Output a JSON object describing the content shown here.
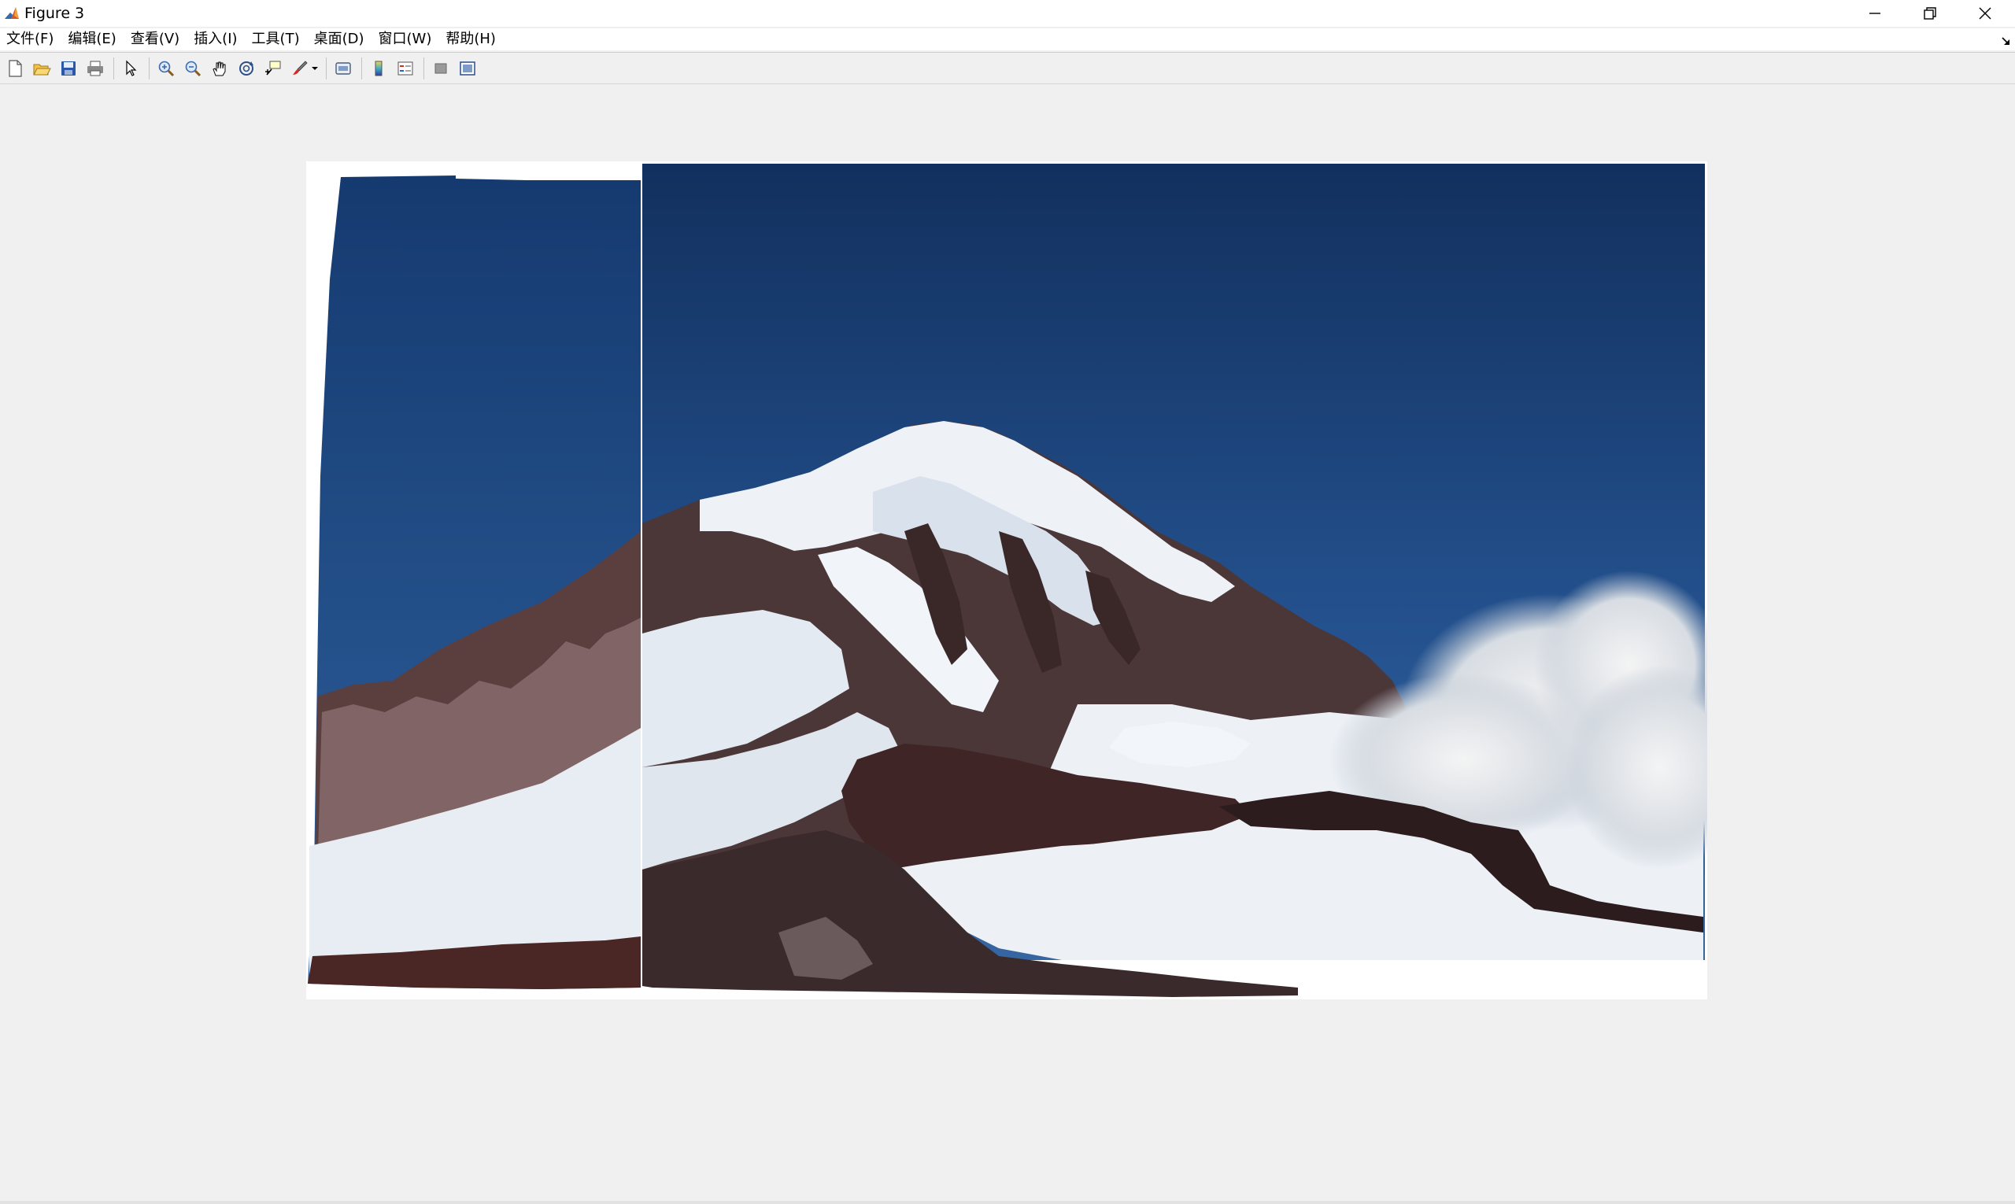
{
  "window": {
    "title": "Figure 3",
    "app_icon": "matlab-icon",
    "controls": {
      "minimize_icon": "minimize-icon",
      "restore_icon": "restore-icon",
      "close_icon": "close-icon"
    }
  },
  "menu": {
    "items": [
      {
        "label": "文件(F)"
      },
      {
        "label": "编辑(E)"
      },
      {
        "label": "查看(V)"
      },
      {
        "label": "插入(I)"
      },
      {
        "label": "工具(T)"
      },
      {
        "label": "桌面(D)"
      },
      {
        "label": "窗口(W)"
      },
      {
        "label": "帮助(H)"
      }
    ],
    "dock_icon": "dock-arrow-icon"
  },
  "toolbar": {
    "buttons": [
      "new-figure-icon",
      "open-file-icon",
      "save-icon",
      "print-icon",
      "edit-plot-icon",
      "zoom-in-icon",
      "zoom-out-icon",
      "pan-icon",
      "rotate-3d-icon",
      "data-cursor-icon",
      "brush-icon",
      "link-plot-icon",
      "insert-colorbar-icon",
      "insert-legend-icon",
      "hide-plot-tools-icon",
      "show-plot-tools-icon"
    ]
  },
  "colors": {
    "sky_top": "#13305e",
    "sky_bottom": "#2c5d96",
    "snow": "#e9eef4",
    "rock": "#3e2c2c",
    "canvas_bg": "#ffffff",
    "window_bg": "#f0f0f0"
  }
}
